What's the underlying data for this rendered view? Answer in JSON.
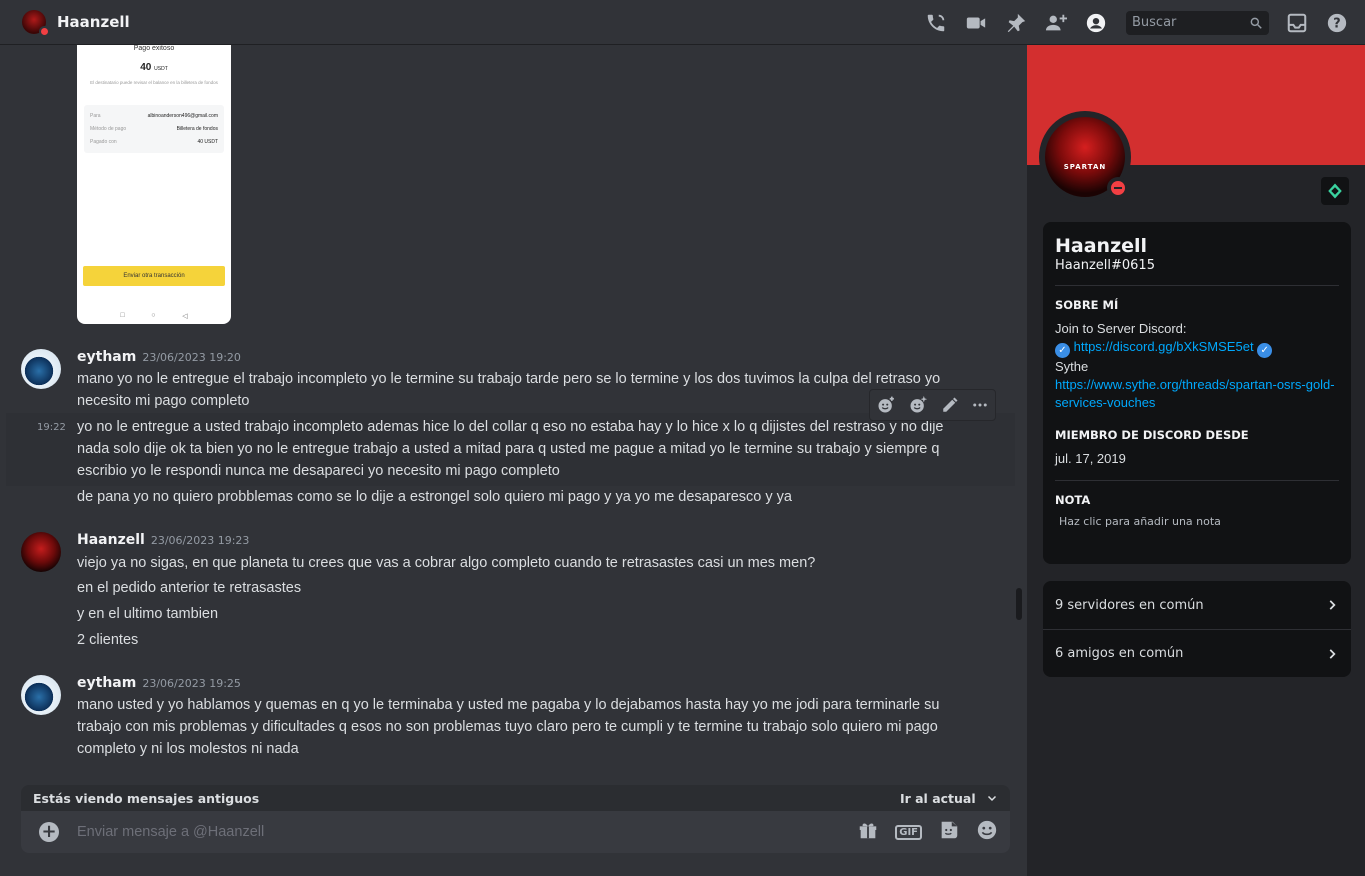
{
  "header": {
    "title": "Haanzell",
    "search_placeholder": "Buscar"
  },
  "attachment": {
    "title": "Pago exitoso",
    "amount": "40",
    "currency": "USDT",
    "note": "El destinatario puede revisar el balance en la billetera de fondos",
    "rows": [
      {
        "key": "Para",
        "value": "albinoanderson496@gmail.com"
      },
      {
        "key": "Método de pago",
        "value": "Billetera de fondos"
      },
      {
        "key": "Pagado con",
        "value": "40 USDT"
      }
    ],
    "button": "Enviar otra transacción",
    "nav": [
      "□",
      "○",
      "◁"
    ]
  },
  "messages": [
    {
      "author": "eytham",
      "timestamp": "23/06/2023 19:20",
      "lines": [
        "mano yo no le entregue el trabajo incompleto yo le termine su trabajo tarde pero se lo termine y los dos tuvimos la culpa del retraso  yo necesito mi pago completo",
        "yo no le entregue a usted  trabajo incompleto ademas hice  lo del collar q eso no estaba hay  y lo hice x lo q dijistes del restraso y no dije nada solo dije ok ta bien    yo no le entregue trabajo a usted a mitad para q usted me pague a mitad   yo le termine su trabajo y siempre q escribio yo le respondi  nunca me desapareci  yo necesito mi pago completo",
        "de pana yo no quiero probblemas como se lo dije a estrongel   solo quiero mi pago y ya  yo me desaparesco  y ya"
      ],
      "side_timestamp": "19:22"
    },
    {
      "author": "Haanzell",
      "timestamp": "23/06/2023 19:23",
      "lines": [
        "viejo ya no sigas, en que planeta tu crees que vas a cobrar algo completo cuando te retrasastes casi un mes men?",
        "en el pedido anterior te retrasastes",
        "y en el ultimo tambien",
        "2 clientes"
      ]
    },
    {
      "author": "eytham",
      "timestamp": "23/06/2023 19:25",
      "lines": [
        "mano usted  y yo hablamos   y quemas en q yo le terminaba y usted me pagaba   y lo dejabamos hasta hay   yo me jodi para terminarle su trabajo   con mis problemas y dificultades q esos no son problemas tuyo claro pero te cumpli y te termine tu trabajo solo quiero mi pago completo y  ni los molestos ni nada"
      ]
    }
  ],
  "old_banner": {
    "text": "Estás viendo mensajes antiguos",
    "jump": "Ir al actual"
  },
  "composer": {
    "placeholder": "Enviar mensaje a @Haanzell",
    "gif_label": "GIF"
  },
  "profile": {
    "banner_color": "#d32f2f",
    "logo_text": "SPARTAN",
    "name": "Haanzell",
    "tag": "Haanzell#0615",
    "about_heading": "SOBRE MÍ",
    "about_line1": "Join to Server Discord:",
    "about_link1": "https://discord.gg/bXkSMSE5et",
    "about_line2": "Sythe",
    "about_link2": "https://www.sythe.org/threads/spartan-osrs-gold-services-vouches",
    "member_heading": "MIEMBRO DE DISCORD DESDE",
    "member_since": "jul. 17, 2019",
    "note_heading": "NOTA",
    "note_placeholder": "Haz clic para añadir una nota",
    "mutual_servers": "9 servidores en común",
    "mutual_friends": "6 amigos en común"
  }
}
